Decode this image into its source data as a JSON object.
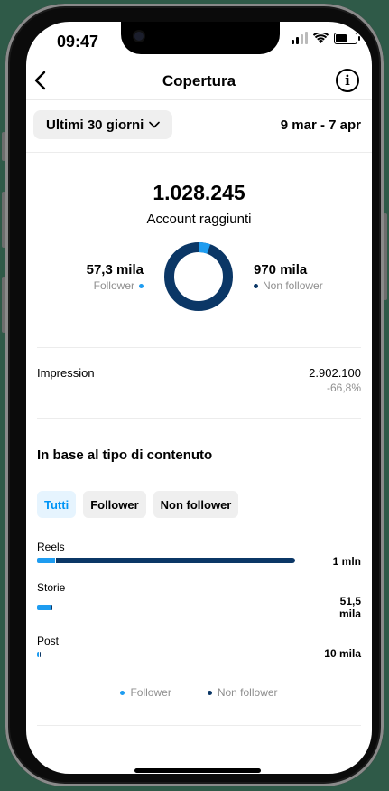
{
  "status": {
    "time": "09:47"
  },
  "header": {
    "title": "Copertura"
  },
  "filter": {
    "range_label": "Ultimi 30 giorni",
    "dates": "9 mar - 7 apr"
  },
  "reach": {
    "total": "1.028.245",
    "total_label": "Account raggiunti",
    "followers_value": "57,3 mila",
    "followers_label": "Follower",
    "non_followers_value": "970 mila",
    "non_followers_label": "Non follower",
    "follower_fraction": 0.056
  },
  "impressions": {
    "label": "Impression",
    "value": "2.902.100",
    "delta": "-66,8%"
  },
  "content_type": {
    "title": "In base al tipo di contenuto",
    "chips": [
      {
        "label": "Tutti",
        "active": true
      },
      {
        "label": "Follower",
        "active": false
      },
      {
        "label": "Non follower",
        "active": false
      }
    ],
    "rows": [
      {
        "label": "Reels",
        "value": "1 mln",
        "follower_fraction": 0.07,
        "total_fraction": 1.0
      },
      {
        "label": "Storie",
        "value": "51,5 mila",
        "follower_fraction": 0.85,
        "total_fraction": 0.06
      },
      {
        "label": "Post",
        "value": "10 mila",
        "follower_fraction": 0.5,
        "total_fraction": 0.012
      }
    ]
  },
  "legend": {
    "follower": "Follower",
    "non_follower": "Non follower"
  },
  "colors": {
    "follower": "#1e9cf0",
    "non_follower": "#0b3766",
    "active_chip_text": "#0095f6"
  }
}
